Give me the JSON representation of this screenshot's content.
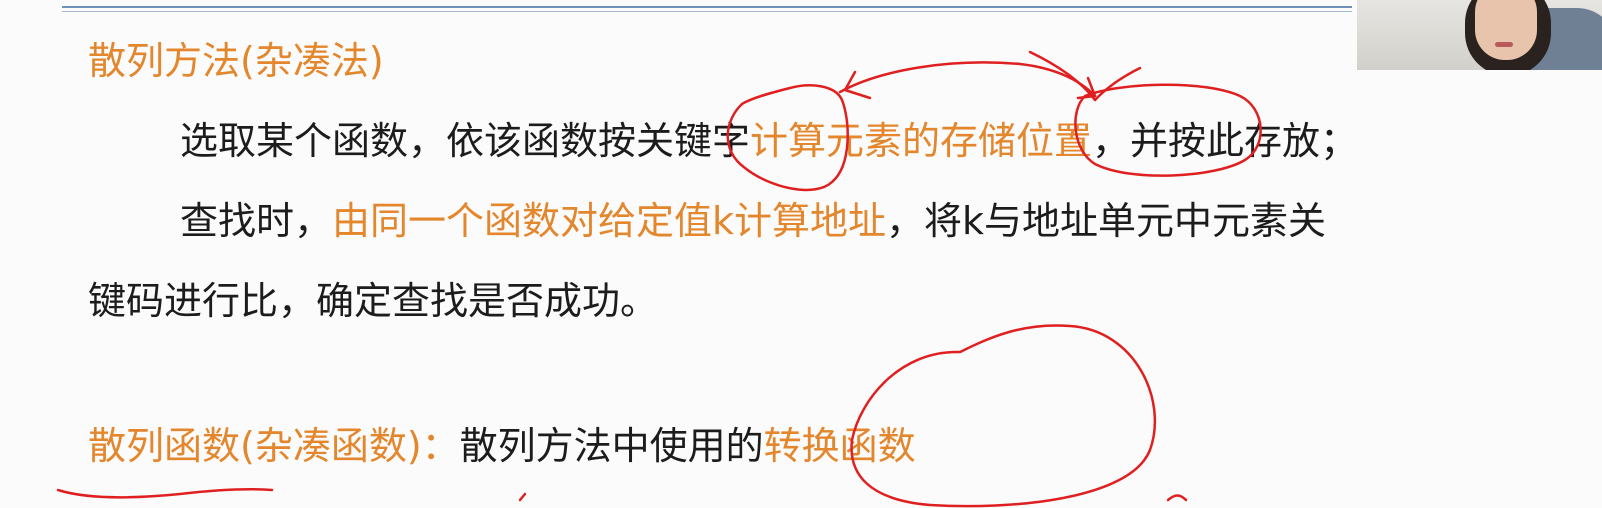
{
  "slide": {
    "section1_heading": "散列方法(杂凑法)",
    "para1": {
      "part1": "选取某个函数，依该函数按关键字",
      "highlight": "计算元素的存储位置",
      "part2": "，并按此存放；"
    },
    "para2": {
      "part1": "查找时，",
      "highlight": "由同一个函数对给定值k计算地址",
      "part2": "，将k与地址单元中元素关"
    },
    "para3": {
      "text": "键码进行比，确定查找是否成功。"
    },
    "section2": {
      "heading": "散列函数(杂凑函数)：",
      "text": "散列方法中使用的",
      "highlight": "转换函数"
    }
  },
  "colors": {
    "accent_orange": "#e3862c",
    "body_text": "#1c1c1c",
    "annotation_red": "#e02020",
    "rule_blue": "#6f8fbf"
  },
  "webcam": {
    "icon": "presenter-webcam-thumbnail"
  }
}
